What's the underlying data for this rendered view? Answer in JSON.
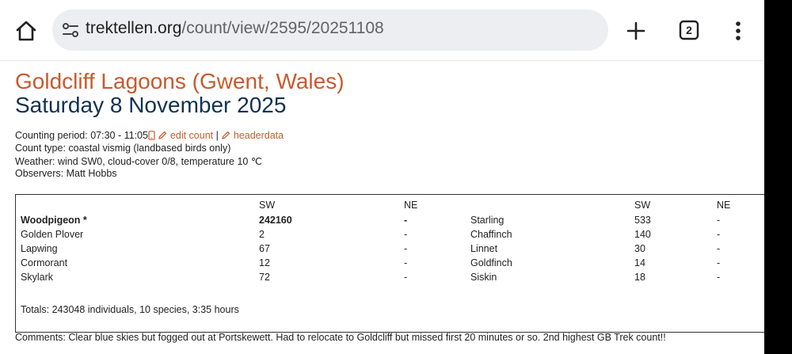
{
  "browser": {
    "url_host": "trektellen.org",
    "url_path": "/count/view/2595/20251108",
    "tab_count": "2",
    "icons": [
      "home-icon",
      "site-info-icon",
      "new-tab-icon",
      "tab-switcher-icon",
      "more-menu-icon"
    ]
  },
  "page": {
    "site_title": "Goldcliff Lagoons (Gwent, Wales)",
    "date_title": "Saturday 8 November 2025",
    "counting_period": "Counting period: 07:30 - 11:05",
    "edit_count": "edit count",
    "separator": "|",
    "headerdata": "headerdata",
    "count_type": "Count type: coastal vismig (landbased birds only)",
    "weather": "Weather: wind SW0, cloud-cover 0/8, temperature 10 ℃",
    "observers": "Observers: Matt Hobbs",
    "colors": {
      "title": "#c85a2e",
      "date": "#12324f",
      "link": "#c85a2e"
    }
  },
  "table": {
    "col_headers": {
      "sw": "SW",
      "ne": "NE"
    },
    "left": [
      {
        "species": "Woodpigeon *",
        "sw": "242160",
        "ne": "-",
        "bold": true
      },
      {
        "species": "Golden Plover",
        "sw": "2",
        "ne": "-"
      },
      {
        "species": "Lapwing",
        "sw": "67",
        "ne": "-"
      },
      {
        "species": "Cormorant",
        "sw": "12",
        "ne": "-"
      },
      {
        "species": "Skylark",
        "sw": "72",
        "ne": "-"
      }
    ],
    "right": [
      {
        "species": "Starling",
        "sw": "533",
        "ne": "-"
      },
      {
        "species": "Chaffinch",
        "sw": "140",
        "ne": "-"
      },
      {
        "species": "Linnet",
        "sw": "30",
        "ne": "-"
      },
      {
        "species": "Goldfinch",
        "sw": "14",
        "ne": "-"
      },
      {
        "species": "Siskin",
        "sw": "18",
        "ne": "-"
      }
    ],
    "totals": "Totals: 243048 individuals, 10 species, 3:35 hours"
  },
  "comments": "Comments: Clear blue skies but fogged out at Portskewett. Had to relocate to Goldcliff but missed first 20 minutes or so. 2nd highest GB Trek count!!"
}
